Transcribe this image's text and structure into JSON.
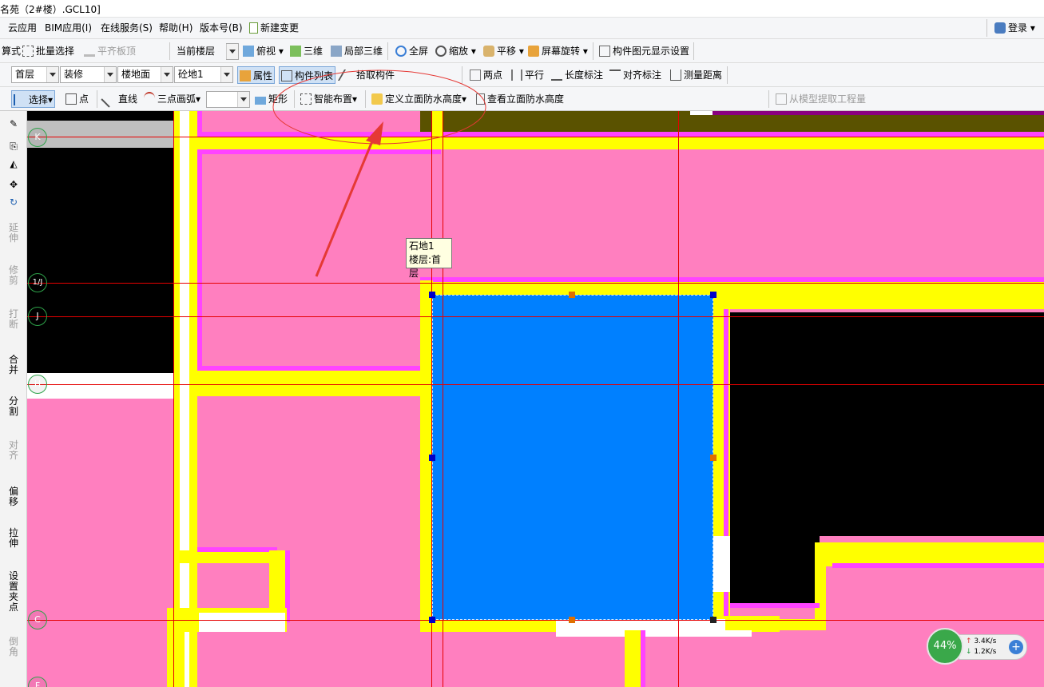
{
  "title": "名苑（2#楼）.GCL10]",
  "menu": {
    "items": [
      "云应用",
      "BIM应用(I)",
      "在线服务(S)",
      "帮助(H)",
      "版本号(B)"
    ],
    "new_change": "新建变更",
    "login": "登录"
  },
  "toolbar1": {
    "cut_text": "算式",
    "batch_select": "批量选择",
    "flush_slab_top": "平齐板顶",
    "current_floor": "当前楼层",
    "top_view": "俯视",
    "three_d": "三维",
    "local_3d": "局部三维",
    "fullscreen": "全屏",
    "zoom": "缩放",
    "pan": "平移",
    "screen_rotate": "屏幕旋转",
    "element_display": "构件图元显示设置"
  },
  "toolbar2": {
    "floor": "首层",
    "category": "装修",
    "type": "楼地面",
    "element": "砼地1",
    "properties": "属性",
    "component_list": "构件列表",
    "pick_component": "拾取构件",
    "two_points": "两点",
    "parallel": "平行",
    "length_dim": "长度标注",
    "align_dim": "对齐标注",
    "measure": "测量距离"
  },
  "toolbar3": {
    "select": "选择",
    "point": "点",
    "line": "直线",
    "arc": "三点画弧",
    "rect": "矩形",
    "smart_layout": "智能布置",
    "define_waterproof": "定义立面防水高度",
    "view_waterproof": "查看立面防水高度",
    "extract_from_model": "从模型提取工程量"
  },
  "left_tools": {
    "extend": "延伸",
    "trim": "修剪",
    "break": "打断",
    "merge": "合并",
    "split": "分割",
    "align": "对齐",
    "offset": "偏移",
    "stretch": "拉伸",
    "set_grip": "设置夹点",
    "chamfer": "倒角"
  },
  "axes": [
    "K",
    "1/J",
    "J",
    "H",
    "C",
    "F"
  ],
  "tooltip": {
    "name": "石地1",
    "floor_label": "楼层:首层"
  },
  "network": {
    "percent": "44%",
    "up": "3.4K/s",
    "down": "1.2K/s"
  },
  "colors": {
    "floor_fill": "#ff7fbf",
    "wall_yellow": "#ffff00",
    "wall_magenta": "#ff44ff",
    "selected_blue": "#0080ff",
    "grid_red": "#e60000",
    "olive_beam": "#5a5200",
    "annotation_red": "#e53935"
  }
}
